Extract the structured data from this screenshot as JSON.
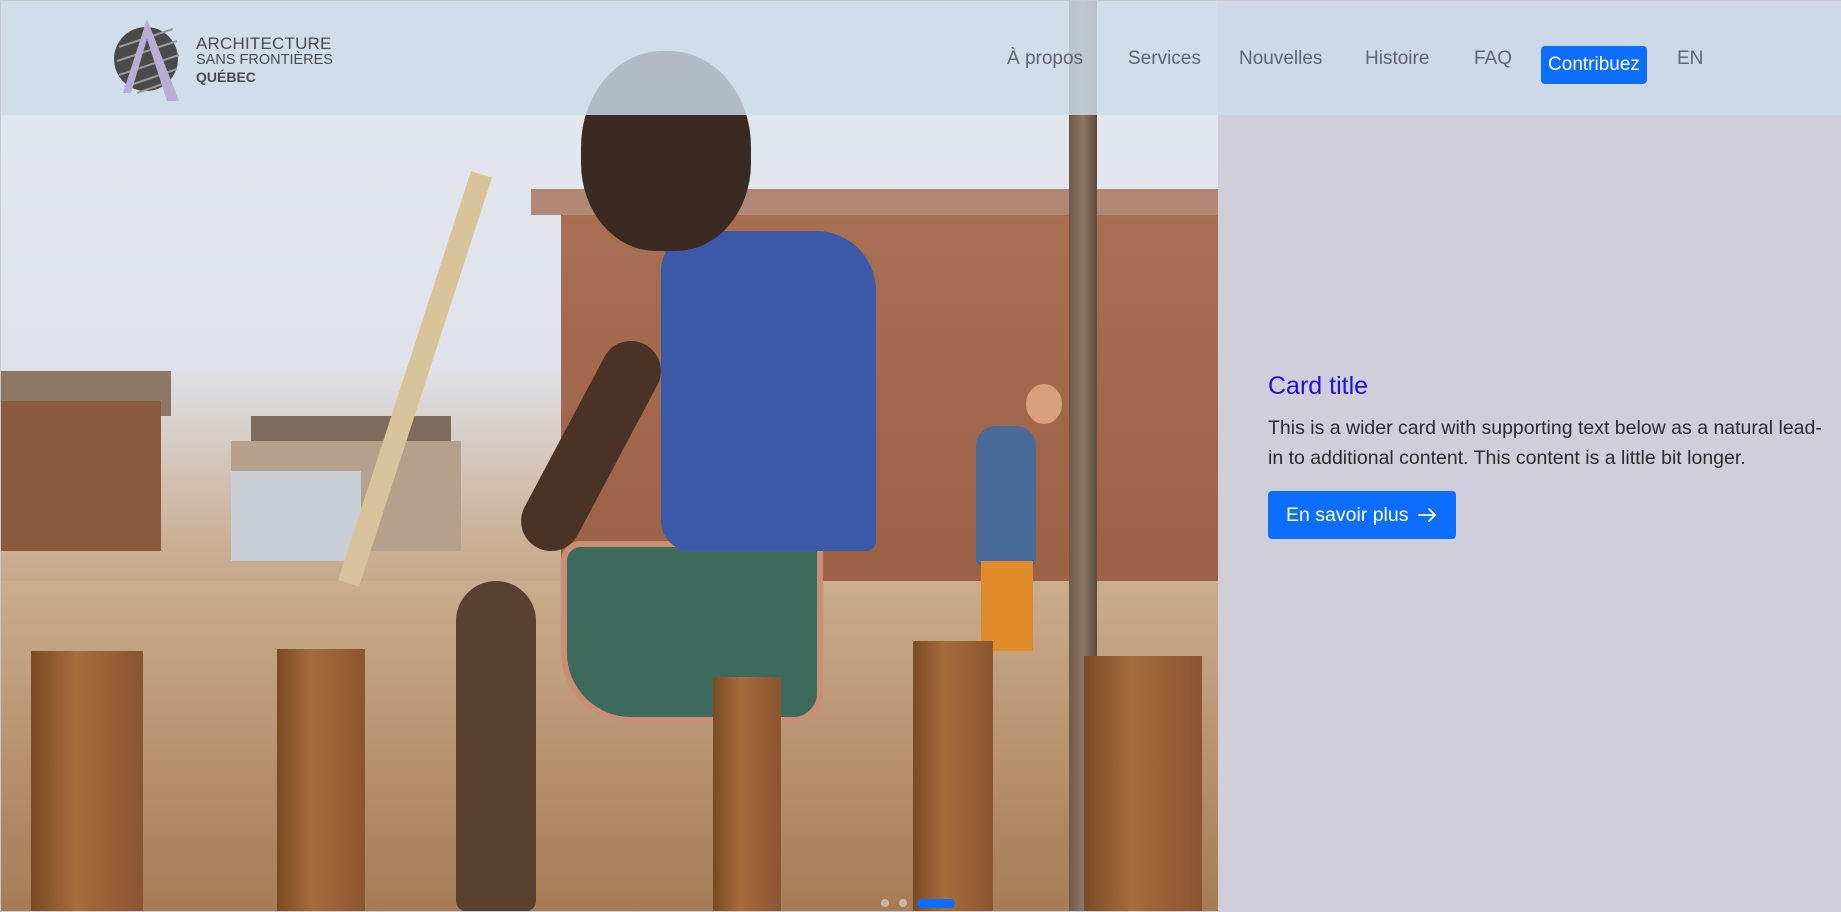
{
  "brand": {
    "logo_line1": "ARCHITECTURE",
    "logo_line2": "SANS FRONTIÈRES",
    "logo_line3": "QUÉBEC",
    "logo_icon": "triangle-a-logo"
  },
  "nav": {
    "items": [
      {
        "label": "À propos"
      },
      {
        "label": "Services"
      },
      {
        "label": "Nouvelles"
      },
      {
        "label": "Histoire"
      },
      {
        "label": "FAQ"
      }
    ],
    "cta_label": "Contribuez",
    "lang_label": "EN"
  },
  "hero": {
    "image_alt": "Child sitting on wooden post at construction site"
  },
  "card": {
    "title": "Card title",
    "text": "This is a wider card with supporting text below as a natural lead-in to additional content. This content is a little bit longer.",
    "button_label": "En savoir plus",
    "button_icon": "arrow-right-icon"
  },
  "carousel": {
    "slide_count": 3,
    "active_index": 2
  },
  "colors": {
    "accent": "#0d6efd",
    "title": "#1f11d8",
    "panel_bg": "#d1cedc",
    "header_bg": "#ccdcec"
  }
}
